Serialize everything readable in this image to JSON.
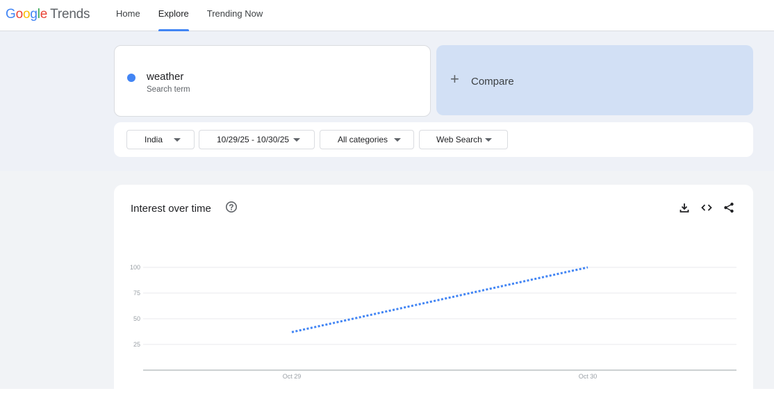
{
  "header": {
    "logo_google": [
      "G",
      "o",
      "o",
      "g",
      "l",
      "e"
    ],
    "logo_trends": "Trends",
    "nav": [
      {
        "label": "Home",
        "active": false
      },
      {
        "label": "Explore",
        "active": true
      },
      {
        "label": "Trending Now",
        "active": false
      }
    ]
  },
  "search": {
    "term": "weather",
    "term_type": "Search term",
    "term_color": "#4285f4",
    "compare_label": "Compare"
  },
  "filters": {
    "region": "India",
    "date_range": "10/29/25 - 10/30/25",
    "category": "All categories",
    "search_type": "Web Search"
  },
  "chart_card": {
    "title": "Interest over time",
    "icons": [
      "help-icon",
      "download-icon",
      "embed-icon",
      "share-icon"
    ]
  },
  "chart_data": {
    "type": "line",
    "categories": [
      "Oct 29",
      "Oct 30"
    ],
    "series": [
      {
        "name": "weather",
        "values": [
          37,
          100
        ],
        "color": "#4285f4",
        "style": "dotted"
      }
    ],
    "ylim": [
      0,
      100
    ],
    "yticks": [
      25,
      50,
      75,
      100
    ],
    "grid": true
  }
}
